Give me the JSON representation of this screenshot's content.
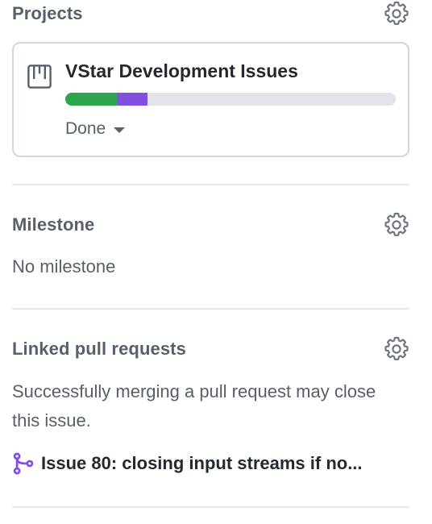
{
  "projects": {
    "title": "Projects",
    "settings_icon": "gear-icon",
    "project": {
      "icon": "project-board-icon",
      "name": "VStar Development Issues",
      "progress": {
        "done_fraction": 0.155,
        "in_progress_fraction": 0.095,
        "done_color": "#2da44e",
        "in_progress_color": "#8250df",
        "track_color": "#e1e5e9"
      },
      "status": "Done"
    }
  },
  "milestone": {
    "title": "Milestone",
    "settings_icon": "gear-icon",
    "value": "No milestone"
  },
  "linked_prs": {
    "title": "Linked pull requests",
    "settings_icon": "gear-icon",
    "description": "Successfully merging a pull request may close this issue.",
    "items": [
      {
        "icon": "git-merge-icon",
        "icon_color": "#8250df",
        "title": "Issue 80: closing input streams if no..."
      }
    ]
  }
}
